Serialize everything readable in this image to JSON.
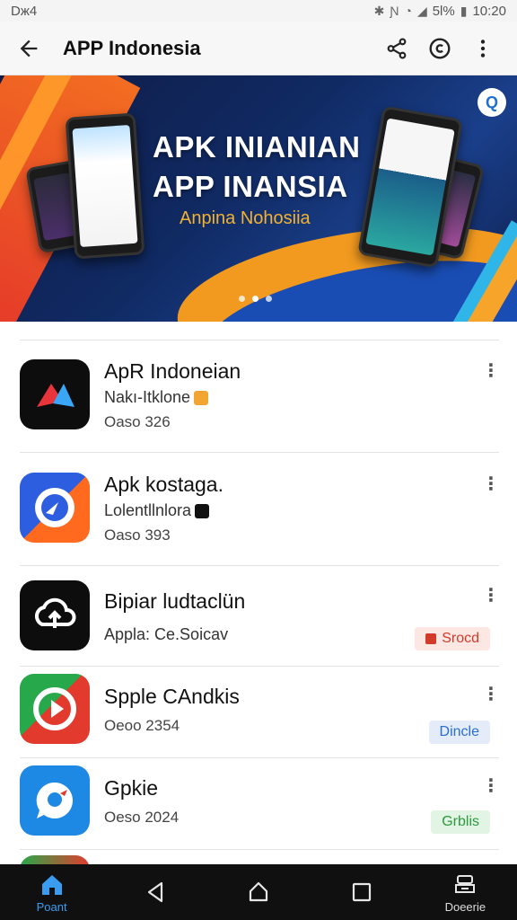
{
  "status_bar": {
    "left_text": "Dж4",
    "battery_text": "5l%",
    "time": "10:20",
    "icons": [
      "bluetooth-icon",
      "nfc-icon",
      "wifi-icon",
      "signal-icon",
      "battery-icon"
    ]
  },
  "app_bar": {
    "title": "APP Indonesia",
    "icons": [
      "back-arrow-icon",
      "share-icon",
      "copyright-icon",
      "more-vert-icon"
    ]
  },
  "banner": {
    "headline_line1": "APK INIANIAN",
    "headline_line2": "APP INANSIA",
    "subtitle": "Anpina Nohosiia",
    "badge_text": "Q",
    "carousel_dots": 3,
    "active_dot": 2
  },
  "apps": [
    {
      "title": "ApR Indoneian",
      "subtitle": "Nakı-Itklone",
      "meta": "Oaso 326",
      "icon": "arrow-logo-icon",
      "colors": {
        "bg": "#0d0d0d",
        "accent1": "#e8343b",
        "accent2": "#3aa6f5"
      }
    },
    {
      "title": "Apk kostaga.",
      "subtitle": "Lolentllnlora",
      "meta": "Oaso 393",
      "icon": "chat-bubble-logo-icon",
      "colors": {
        "bg": "#2d5ee0",
        "accent1": "#ff6a1f",
        "accent2": "#ffffff"
      }
    },
    {
      "title": "Bipiar ludtaclün",
      "subtitle": "Appla: Ce.Soicav",
      "meta": "",
      "icon": "cloud-upload-icon",
      "pill": {
        "label": "Srocd",
        "bg": "#fde7e3",
        "color": "#d23b2a"
      },
      "colors": {
        "bg": "#0d0d0d",
        "accent1": "#ffffff",
        "accent2": "#ffffff"
      }
    },
    {
      "title": "Spple CAndkis",
      "subtitle": "",
      "meta": "Oeoo 2354",
      "icon": "play-circle-icon",
      "pill": {
        "label": "Dincle",
        "bg": "#e3ecf8",
        "color": "#2a6ed1"
      },
      "colors": {
        "bg": "#e23b2e",
        "accent1": "#27a84a",
        "accent2": "#ffffff"
      }
    },
    {
      "title": "Gpkie",
      "subtitle": "",
      "meta": "Oeso 2024",
      "icon": "chat-bird-icon",
      "pill": {
        "label": "Grblis",
        "bg": "#e2f4e3",
        "color": "#2c9a3e"
      },
      "colors": {
        "bg": "#1e88e5",
        "accent1": "#ffffff",
        "accent2": "#e23b2e"
      }
    }
  ],
  "bottom_nav": {
    "items": [
      {
        "label": "Poant",
        "icon": "home-icon",
        "active": true
      },
      {
        "label": "",
        "icon": "back-triangle-icon",
        "active": false
      },
      {
        "label": "",
        "icon": "home-circle-icon",
        "active": false
      },
      {
        "label": "",
        "icon": "recents-square-icon",
        "active": false
      },
      {
        "label": "Doeerie",
        "icon": "downloads-icon",
        "active": false
      }
    ]
  }
}
